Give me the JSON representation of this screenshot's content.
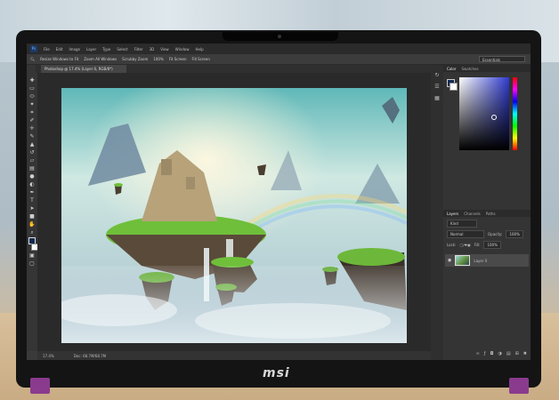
{
  "device": {
    "brand": "msi"
  },
  "menubar": {
    "logo": "Ps",
    "items": [
      "File",
      "Edit",
      "Image",
      "Layer",
      "Type",
      "Select",
      "Filter",
      "3D",
      "View",
      "Window",
      "Help"
    ]
  },
  "options": {
    "items": [
      "Resize Windows to Fit",
      "Zoom All Windows",
      "Scrubby Zoom",
      "100%",
      "Fit Screen",
      "Fill Screen"
    ],
    "workspace": "Essentials"
  },
  "document": {
    "tab_title": "Photoshop @ 17.4% (Layer 0, RGB/8*)"
  },
  "status": {
    "zoom": "17.4%",
    "info": "Doc: 68.7M/68.7M"
  },
  "panels": {
    "color_tabs": [
      "Color",
      "Swatches"
    ],
    "layers_tabs": [
      "Layers",
      "Channels",
      "Paths"
    ],
    "kind_filter": "Kind",
    "blend_mode": "Normal",
    "opacity_label": "Opacity:",
    "opacity_value": "100%",
    "lock_label": "Lock:",
    "fill_label": "Fill:",
    "fill_value": "100%",
    "layer_name": "Layer 0"
  },
  "colors": {
    "foreground": "#102a55",
    "background": "#ffffff",
    "accent": "#2f3bd0",
    "hinge": "#8a3b8e"
  },
  "icons": {
    "tools": [
      "move-icon",
      "marquee-icon",
      "lasso-icon",
      "quick-select-icon",
      "crop-icon",
      "eyedropper-icon",
      "healing-icon",
      "brush-icon",
      "stamp-icon",
      "history-brush-icon",
      "eraser-icon",
      "gradient-icon",
      "blur-icon",
      "dodge-icon",
      "pen-icon",
      "type-icon",
      "path-select-icon",
      "shape-icon",
      "hand-icon",
      "zoom-icon"
    ],
    "side_strip": [
      "history-icon",
      "properties-icon",
      "libraries-icon"
    ],
    "layer_footer": [
      "link-icon",
      "fx-icon",
      "mask-icon",
      "adjustment-icon",
      "folder-icon",
      "new-layer-icon",
      "trash-icon"
    ]
  }
}
